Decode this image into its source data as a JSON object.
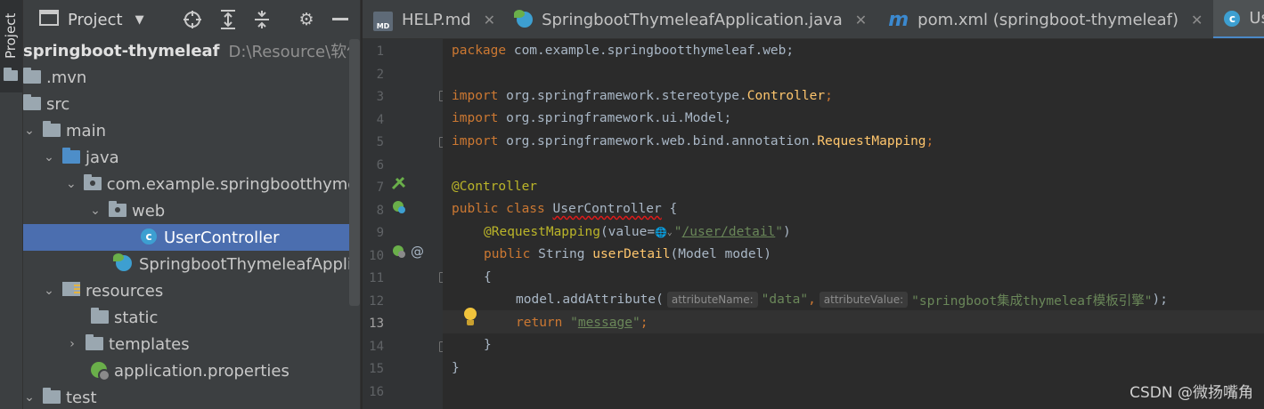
{
  "toolstrip": {
    "project_tab_label": "Project"
  },
  "project_panel": {
    "title": "Project",
    "tree": [
      {
        "label": "springboot-thymeleaf",
        "path": "D:\\Resource\\软件技术",
        "icon": "module-folder-icon",
        "expanded": true
      },
      {
        "label": ".mvn",
        "icon": "folder-icon",
        "expanded": false
      },
      {
        "label": "src",
        "icon": "folder-icon",
        "expanded": true
      },
      {
        "label": "main",
        "icon": "folder-icon",
        "expanded": true
      },
      {
        "label": "java",
        "icon": "source-folder-icon",
        "expanded": true
      },
      {
        "label": "com.example.springbootthymeleaf",
        "icon": "package-icon",
        "expanded": true
      },
      {
        "label": "web",
        "icon": "package-icon",
        "expanded": true
      },
      {
        "label": "UserController",
        "icon": "class-icon",
        "selected": true
      },
      {
        "label": "SpringbootThymeleafApplication",
        "icon": "spring-boot-class-icon"
      },
      {
        "label": "resources",
        "icon": "resources-folder-icon",
        "expanded": true
      },
      {
        "label": "static",
        "icon": "folder-icon"
      },
      {
        "label": "templates",
        "icon": "folder-icon",
        "expanded": false
      },
      {
        "label": "application.properties",
        "icon": "spring-properties-icon"
      },
      {
        "label": "test",
        "icon": "folder-icon",
        "expanded": true
      }
    ]
  },
  "tabs": [
    {
      "label": "HELP.md",
      "icon": "markdown-file-icon",
      "closable": true
    },
    {
      "label": "SpringbootThymeleafApplication.java",
      "icon": "spring-boot-class-icon",
      "closable": true
    },
    {
      "label": "pom.xml (springboot-thymeleaf)",
      "icon": "maven-icon",
      "closable": true
    },
    {
      "label": "UserController.java",
      "icon": "class-icon",
      "active": true
    }
  ],
  "md_icon_text": "MD",
  "editor": {
    "current_line": 13,
    "line_numbers": [
      "1",
      "2",
      "3",
      "4",
      "5",
      "6",
      "7",
      "8",
      "9",
      "10",
      "11",
      "12",
      "13",
      "14",
      "15",
      "16"
    ],
    "lines": {
      "l1_kw": "package",
      "l1_rest": " com.example.springbootthymeleaf.web;",
      "l3_kw": "import",
      "l3_pkg": " org.springframework.stereotype.",
      "l3_cls": "Controller",
      "l3_end": ";",
      "l4_kw": "import",
      "l4_pkg": " org.springframework.ui.Model;",
      "l5_kw": "import",
      "l5_pkg": " org.springframework.web.bind.annotation.",
      "l5_cls": "RequestMapping",
      "l5_end": ";",
      "l7_ann": "@Controller",
      "l8_kw": "public class ",
      "l8_name": "UserController",
      "l8_end": " {",
      "l9_ann": "@RequestMapping",
      "l9_open": "(value=",
      "l9_glob": "🌐",
      "l9_str_q1": "\"",
      "l9_url": "/user/detail",
      "l9_str_q2": "\"",
      "l9_close": ")",
      "l10_kw": "public ",
      "l10_type": "String ",
      "l10_fn": "userDetail",
      "l10_params": "(Model model)",
      "l11_brace": "{",
      "l12_call": "model.addAttribute(",
      "l12_hint1": "attributeName:",
      "l12_str1": "\"data\"",
      "l12_comma": ",",
      "l12_hint2": "attributeValue:",
      "l12_str2": "\"springboot集成thymeleaf模板引擎\"",
      "l12_end": ");",
      "l13_kw": "return ",
      "l13_q1": "\"",
      "l13_str": "message",
      "l13_q2": "\"",
      "l13_end": ";",
      "l14_brace": "}",
      "l15_brace": "}"
    }
  },
  "watermark": "CSDN @微扬嘴角"
}
